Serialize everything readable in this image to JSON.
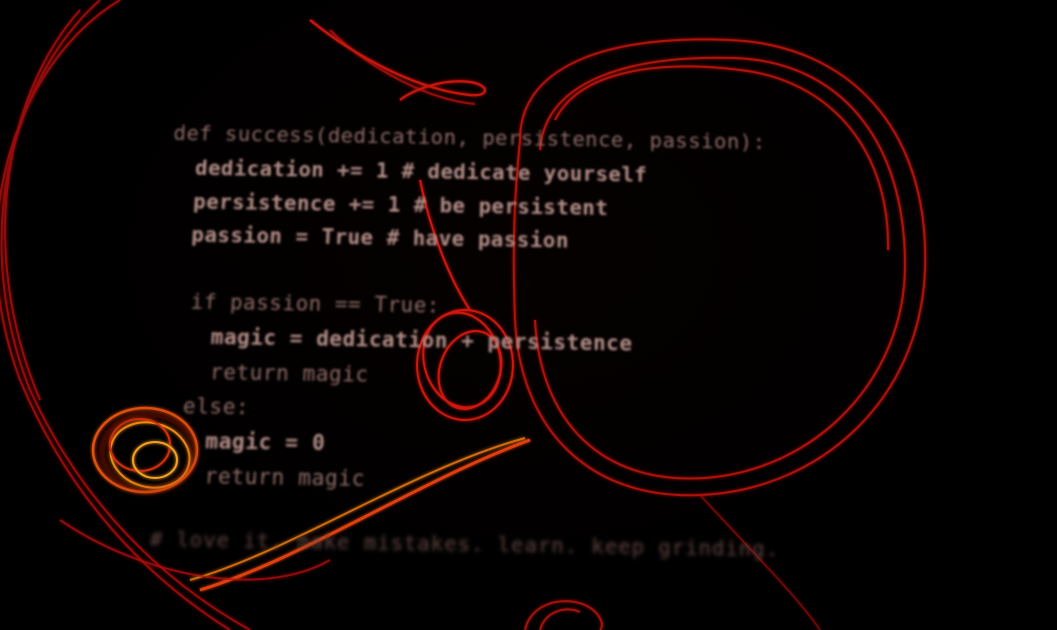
{
  "code": {
    "line1": "def success(dedication, persistence, passion):",
    "line2": "dedication += 1 # dedicate yourself",
    "line3": "persistence += 1 # be persistent",
    "line4": "passion = True # have passion",
    "line5": "if passion == True:",
    "line6": "magic = dedication + persistence",
    "line7": "return magic",
    "line8": "else:",
    "line9": "magic = 0",
    "line10": "return magic",
    "footer_comment": "# love it. make mistakes. learn. keep grinding."
  },
  "colors": {
    "background": "#000000",
    "text": "#a38480",
    "swirl_red": "#d4140f",
    "swirl_orange": "#f07a10"
  }
}
